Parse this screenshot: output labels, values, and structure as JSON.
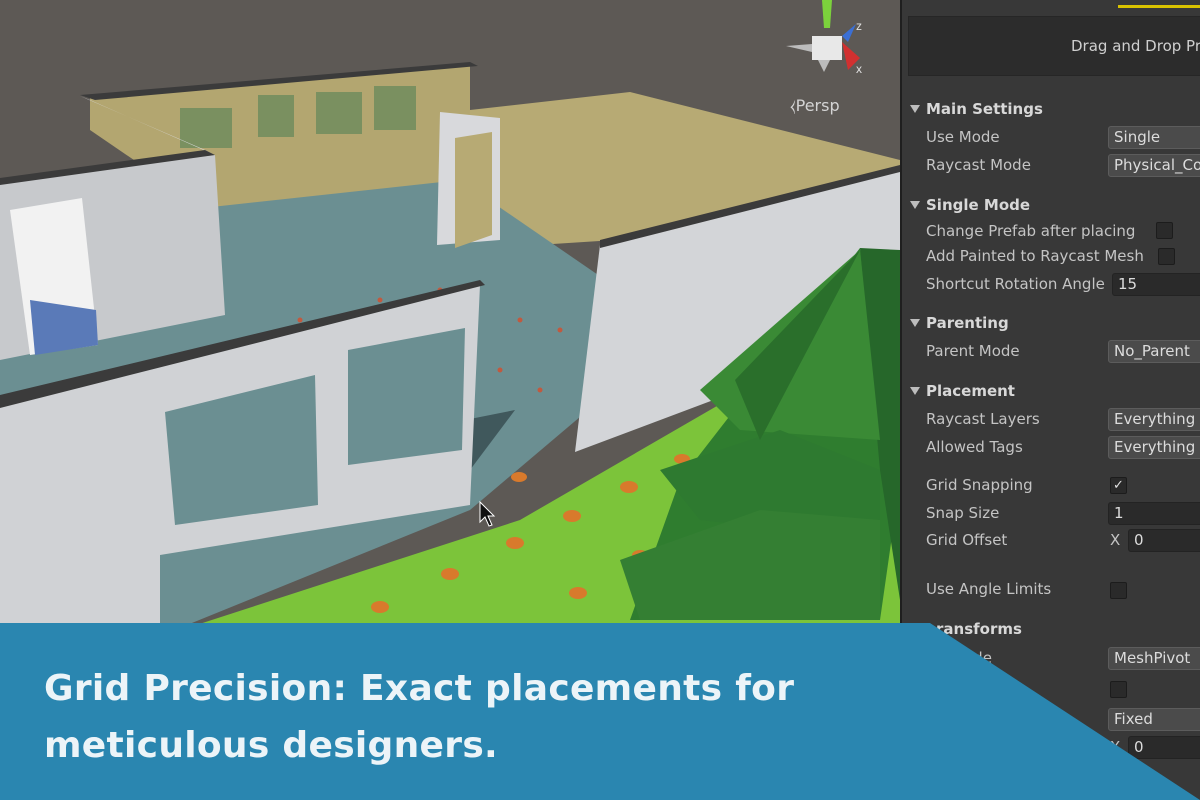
{
  "scene": {
    "view_mode": "Persp",
    "gizmo_axes": [
      "y",
      "z",
      "x"
    ]
  },
  "inspector": {
    "drop_area_text": "Drag and Drop Pr",
    "sections": {
      "main": {
        "title": "Main Settings",
        "use_mode_label": "Use Mode",
        "use_mode_value": "Single",
        "raycast_mode_label": "Raycast Mode",
        "raycast_mode_value": "Physical_Co"
      },
      "single": {
        "title": "Single Mode",
        "change_prefab_label": "Change Prefab after placing",
        "change_prefab_checked": false,
        "add_painted_label": "Add Painted to Raycast Mesh",
        "add_painted_checked": false,
        "rotation_label": "Shortcut Rotation Angle",
        "rotation_value": "15"
      },
      "parenting": {
        "title": "Parenting",
        "parent_mode_label": "Parent Mode",
        "parent_mode_value": "No_Parent"
      },
      "placement": {
        "title": "Placement",
        "raycast_layers_label": "Raycast Layers",
        "raycast_layers_value": "Everything",
        "allowed_tags_label": "Allowed Tags",
        "allowed_tags_value": "Everything",
        "grid_snapping_label": "Grid Snapping",
        "grid_snapping_checked": true,
        "check_mark": "✓",
        "snap_size_label": "Snap Size",
        "snap_size_value": "1",
        "grid_offset_label": "Grid Offset",
        "grid_offset_axis": "X",
        "grid_offset_value": "0",
        "use_angle_label": "Use Angle Limits",
        "use_angle_checked": false
      },
      "transforms": {
        "title": "ransforms",
        "mode_label": "ode",
        "mode_value": "MeshPivot",
        "fixed_value": "Fixed",
        "axis_label": "X",
        "axis_value": "0"
      }
    }
  },
  "banner": {
    "line1": "Grid Precision: Exact placements for",
    "line2": "meticulous designers.",
    "color": "#2a86b0"
  }
}
